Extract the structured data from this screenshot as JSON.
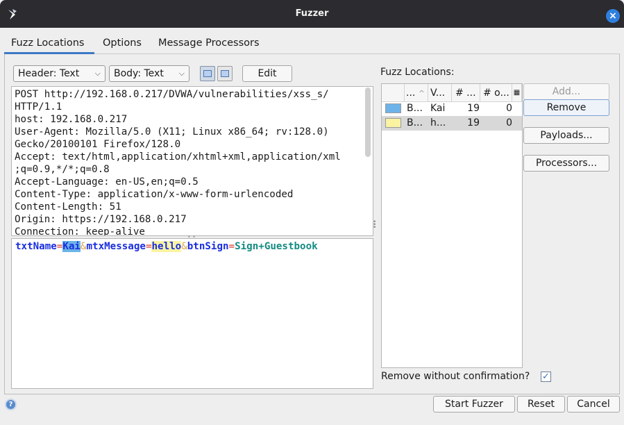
{
  "window": {
    "title": "Fuzzer",
    "colors": {
      "titlebar": "#2b2b30",
      "close": "#2f7fdf",
      "accent": "#3d79c6"
    }
  },
  "tabs": [
    {
      "label": "Fuzz Locations",
      "active": true
    },
    {
      "label": "Options",
      "active": false
    },
    {
      "label": "Message Processors",
      "active": false
    }
  ],
  "toolbar": {
    "header_select": "Header: Text",
    "body_select": "Body: Text",
    "edit_label": "Edit"
  },
  "request": {
    "headers": "POST http://192.168.0.217/DVWA/vulnerabilities/xss_s/\nHTTP/1.1\nhost: 192.168.0.217\nUser-Agent: Mozilla/5.0 (X11; Linux x86_64; rv:128.0)\nGecko/20100101 Firefox/128.0\nAccept: text/html,application/xhtml+xml,application/xml\n;q=0.9,*/*;q=0.8\nAccept-Language: en-US,en;q=0.5\nContent-Type: application/x-www-form-urlencoded\nContent-Length: 51\nOrigin: https://192.168.0.217\nConnection: keep-alive",
    "body_parts": {
      "k1": "txtName",
      "eq1": "=",
      "v1": "Kai",
      "amp1": "&",
      "k2": "mtxMessage",
      "eq2": "=",
      "v2": "hello",
      "amp2": "&",
      "k3": "btnSign",
      "eq3": "=",
      "v3a": "Sign",
      "plus": "+",
      "v3b": "Guestbook"
    }
  },
  "fuzz_locations": {
    "label": "Fuzz Locations:",
    "columns": [
      "...",
      "V...",
      "# ...",
      "# o..."
    ],
    "rows": [
      {
        "name": "B...",
        "value": "Kai",
        "count": "19",
        "other": "0",
        "color": "#6db3ea",
        "selected": false
      },
      {
        "name": "B...",
        "value": "h...",
        "count": "19",
        "other": "0",
        "color": "#f9f3a2",
        "selected": true
      }
    ],
    "buttons": {
      "add": "Add...",
      "remove": "Remove",
      "payloads": "Payloads...",
      "processors": "Processors..."
    },
    "remove_without_confirmation": "Remove without confirmation?",
    "confirmation_checked": true
  },
  "footer": {
    "start": "Start Fuzzer",
    "reset": "Reset",
    "cancel": "Cancel"
  }
}
